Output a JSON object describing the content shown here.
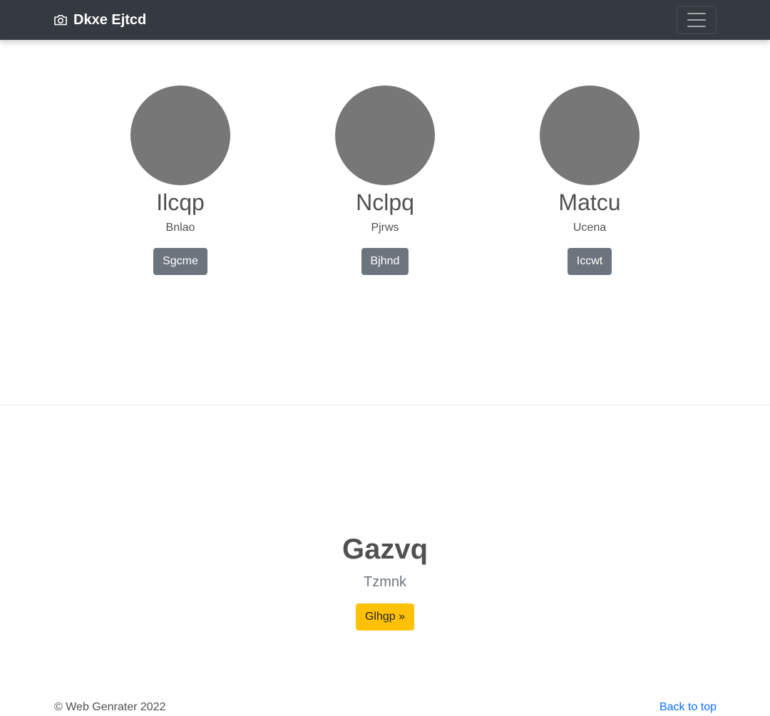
{
  "navbar": {
    "brand_icon": "camera-icon",
    "brand_text": "Dkxe Ejtcd",
    "toggler_icon": "hamburger-icon",
    "background": "#343a40"
  },
  "profiles": [
    {
      "name": "Ilcqp",
      "role": "Bnlao",
      "button_label": "Sgcme"
    },
    {
      "name": "Nclpq",
      "role": "Pjrws",
      "button_label": "Bjhnd"
    },
    {
      "name": "Matcu",
      "role": "Ucena",
      "button_label": "Iccwt"
    }
  ],
  "hero": {
    "title": "Gazvq",
    "subtitle": "Tzmnk",
    "cta_label": "Glhgp »",
    "cta_color": "#ffc107"
  },
  "footer": {
    "copyright": "© Web Genrater 2022",
    "back_to_top": "Back to top",
    "link_color": "#0d6efd"
  },
  "colors": {
    "avatar_placeholder": "#777777",
    "secondary_button": "#6c757d"
  }
}
